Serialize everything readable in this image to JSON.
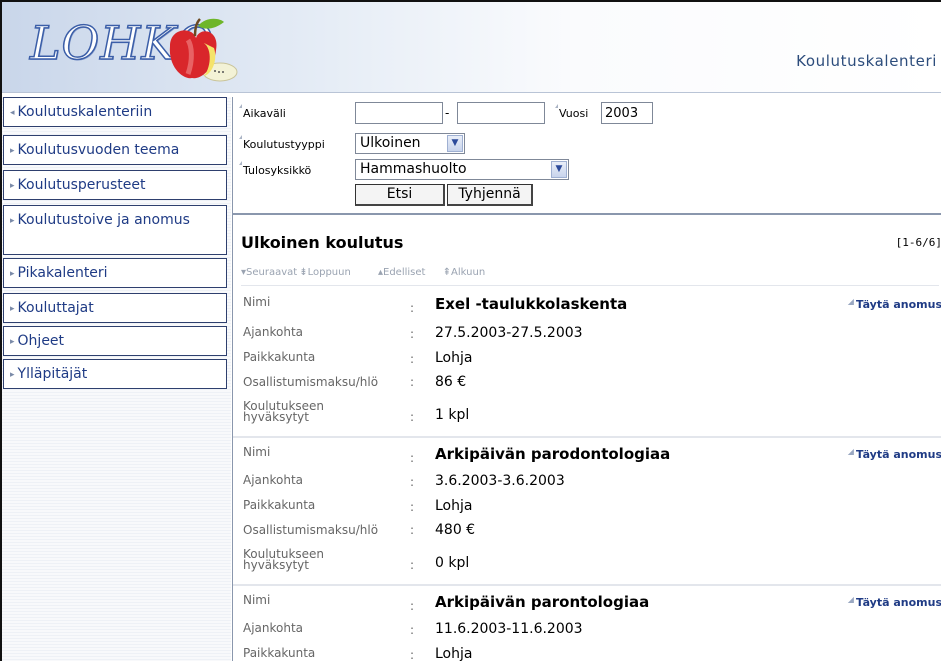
{
  "header": {
    "logo": "LOHKO",
    "title": "Koulutuskalenteri"
  },
  "sidebar": {
    "items": [
      {
        "label": "Koulutuskalenteriin",
        "arrow": "◂"
      },
      {
        "label": "Koulutusvuoden teema",
        "arrow": "▸"
      },
      {
        "label": "Koulutusperusteet",
        "arrow": "▸"
      },
      {
        "label": "Koulutustoive ja anomus",
        "arrow": "▸"
      },
      {
        "label": "Pikakalenteri",
        "arrow": "▸"
      },
      {
        "label": "Kouluttajat",
        "arrow": "▸"
      },
      {
        "label": "Ohjeet",
        "arrow": "▸"
      },
      {
        "label": "Ylläpitäjät",
        "arrow": "▸"
      }
    ]
  },
  "search": {
    "period_label": "Aikaväli",
    "date_from": "",
    "date_to": "",
    "period_dash": "-",
    "year_label": "Vuosi",
    "year_value": "2003",
    "type_label": "Koulutustyyppi",
    "type_value": "Ulkoinen",
    "unit_label": "Tulosyksikkö",
    "unit_value": "Hammashuolto",
    "search_button": "Etsi",
    "clear_button": "Tyhjennä"
  },
  "results": {
    "title": "Ulkoinen koulutus",
    "count": "[1-6/6]",
    "pager": {
      "next": "▾Seuraavat",
      "last": "⇟Loppuun",
      "prev": "▴Edelliset",
      "first": "⇞Alkuun"
    },
    "field_labels": {
      "name": "Nimi",
      "date": "Ajankohta",
      "place": "Paikkakunta",
      "fee": "Osallistumismaksu/hlö",
      "accepted": "Koulutukseen hyväksytyt"
    },
    "apply_label": "Täytä anomus",
    "records": [
      {
        "name": "Exel -taulukkolaskenta",
        "date": "27.5.2003-27.5.2003",
        "place": "Lohja",
        "fee": "86 €",
        "accepted": "1 kpl"
      },
      {
        "name": "Arkipäivän parodontologiaa",
        "date": "3.6.2003-3.6.2003",
        "place": "Lohja",
        "fee": "480 €",
        "accepted": "0 kpl"
      },
      {
        "name": "Arkipäivän parontologiaa",
        "date": "11.6.2003-11.6.2003",
        "place": "Lohja",
        "fee": "",
        "accepted": ""
      }
    ]
  },
  "colors": {
    "nav_text": "#1f3b85",
    "nav_border": "#2e3f6e",
    "header_title": "#2d4d7c"
  }
}
